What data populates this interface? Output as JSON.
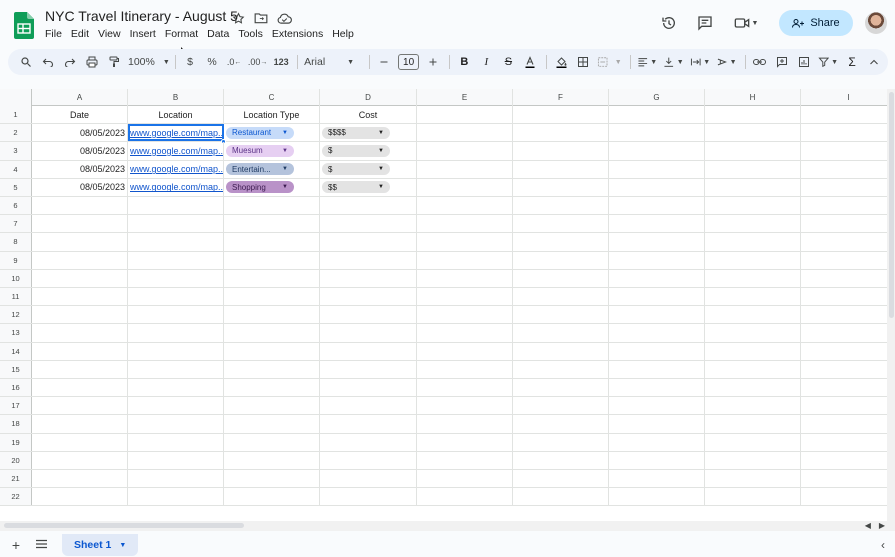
{
  "app": {
    "doc_title": "NYC Travel Itinerary - August 5",
    "menu": [
      "File",
      "Edit",
      "View",
      "Insert",
      "Format",
      "Data",
      "Tools",
      "Extensions",
      "Help"
    ],
    "share_label": "Share"
  },
  "toolbar": {
    "zoom": "100%",
    "currency": "$",
    "percent": "%",
    "dec_decrease": ".0",
    "dec_increase": ".00",
    "number_format": "123",
    "font": "Arial",
    "font_size": "10"
  },
  "grid": {
    "columns": [
      "A",
      "B",
      "C",
      "D",
      "E",
      "F",
      "G",
      "H",
      "I"
    ],
    "row_numbers": [
      "1",
      "2",
      "3",
      "4",
      "5",
      "6",
      "7",
      "8",
      "9",
      "10",
      "11",
      "12",
      "13",
      "14",
      "15",
      "16",
      "17",
      "18",
      "19",
      "20",
      "21",
      "22"
    ],
    "headers": {
      "date": "Date",
      "location": "Location",
      "location_type": "Location Type",
      "cost": "Cost"
    },
    "rows": [
      {
        "date": "08/05/2023",
        "location": "www.google.com/map...",
        "type": "Restaurant",
        "type_color": "#c6dbf9",
        "type_text_color": "#0b57d0",
        "cost": "$$$$"
      },
      {
        "date": "08/05/2023",
        "location": "www.google.com/map...",
        "type": "Muesum",
        "type_color": "#e6cff2",
        "type_text_color": "#5a3286",
        "cost": "$"
      },
      {
        "date": "08/05/2023",
        "location": "www.google.com/map...",
        "type": "Entertain...",
        "type_color": "#b4c3dc",
        "type_text_color": "#1f3a63",
        "cost": "$"
      },
      {
        "date": "08/05/2023",
        "location": "www.google.com/map...",
        "type": "Shopping",
        "type_color": "#b992c8",
        "type_text_color": "#3b1a4f",
        "cost": "$$"
      }
    ],
    "cost_chip_color": "#e3e3e3"
  },
  "sheets": {
    "active": "Sheet 1"
  },
  "colors": {
    "accent": "#1a73e8",
    "share_bg": "#c2e7ff",
    "sheets_green": "#0f9d58"
  }
}
